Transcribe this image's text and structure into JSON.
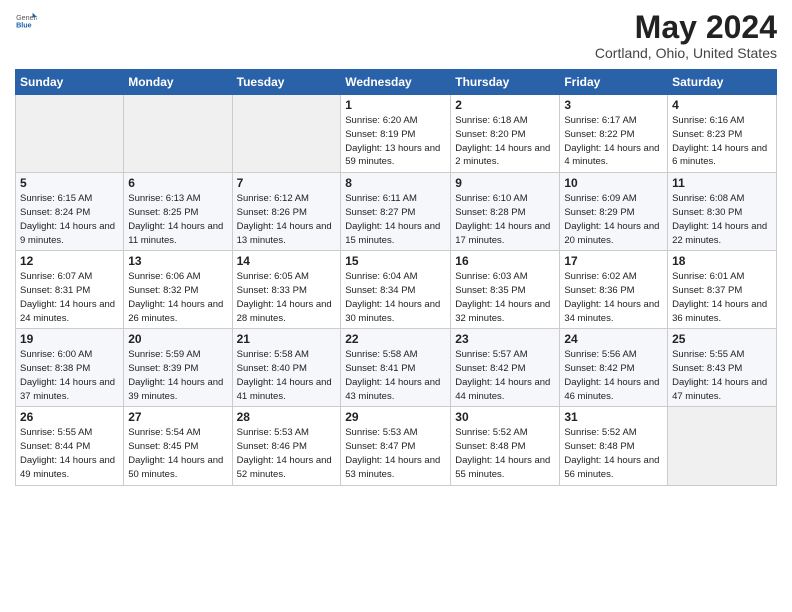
{
  "logo": {
    "general": "General",
    "blue": "Blue"
  },
  "title": "May 2024",
  "location": "Cortland, Ohio, United States",
  "days_of_week": [
    "Sunday",
    "Monday",
    "Tuesday",
    "Wednesday",
    "Thursday",
    "Friday",
    "Saturday"
  ],
  "weeks": [
    [
      {
        "day": "",
        "info": ""
      },
      {
        "day": "",
        "info": ""
      },
      {
        "day": "",
        "info": ""
      },
      {
        "day": "1",
        "info": "Sunrise: 6:20 AM\nSunset: 8:19 PM\nDaylight: 13 hours\nand 59 minutes."
      },
      {
        "day": "2",
        "info": "Sunrise: 6:18 AM\nSunset: 8:20 PM\nDaylight: 14 hours\nand 2 minutes."
      },
      {
        "day": "3",
        "info": "Sunrise: 6:17 AM\nSunset: 8:22 PM\nDaylight: 14 hours\nand 4 minutes."
      },
      {
        "day": "4",
        "info": "Sunrise: 6:16 AM\nSunset: 8:23 PM\nDaylight: 14 hours\nand 6 minutes."
      }
    ],
    [
      {
        "day": "5",
        "info": "Sunrise: 6:15 AM\nSunset: 8:24 PM\nDaylight: 14 hours\nand 9 minutes."
      },
      {
        "day": "6",
        "info": "Sunrise: 6:13 AM\nSunset: 8:25 PM\nDaylight: 14 hours\nand 11 minutes."
      },
      {
        "day": "7",
        "info": "Sunrise: 6:12 AM\nSunset: 8:26 PM\nDaylight: 14 hours\nand 13 minutes."
      },
      {
        "day": "8",
        "info": "Sunrise: 6:11 AM\nSunset: 8:27 PM\nDaylight: 14 hours\nand 15 minutes."
      },
      {
        "day": "9",
        "info": "Sunrise: 6:10 AM\nSunset: 8:28 PM\nDaylight: 14 hours\nand 17 minutes."
      },
      {
        "day": "10",
        "info": "Sunrise: 6:09 AM\nSunset: 8:29 PM\nDaylight: 14 hours\nand 20 minutes."
      },
      {
        "day": "11",
        "info": "Sunrise: 6:08 AM\nSunset: 8:30 PM\nDaylight: 14 hours\nand 22 minutes."
      }
    ],
    [
      {
        "day": "12",
        "info": "Sunrise: 6:07 AM\nSunset: 8:31 PM\nDaylight: 14 hours\nand 24 minutes."
      },
      {
        "day": "13",
        "info": "Sunrise: 6:06 AM\nSunset: 8:32 PM\nDaylight: 14 hours\nand 26 minutes."
      },
      {
        "day": "14",
        "info": "Sunrise: 6:05 AM\nSunset: 8:33 PM\nDaylight: 14 hours\nand 28 minutes."
      },
      {
        "day": "15",
        "info": "Sunrise: 6:04 AM\nSunset: 8:34 PM\nDaylight: 14 hours\nand 30 minutes."
      },
      {
        "day": "16",
        "info": "Sunrise: 6:03 AM\nSunset: 8:35 PM\nDaylight: 14 hours\nand 32 minutes."
      },
      {
        "day": "17",
        "info": "Sunrise: 6:02 AM\nSunset: 8:36 PM\nDaylight: 14 hours\nand 34 minutes."
      },
      {
        "day": "18",
        "info": "Sunrise: 6:01 AM\nSunset: 8:37 PM\nDaylight: 14 hours\nand 36 minutes."
      }
    ],
    [
      {
        "day": "19",
        "info": "Sunrise: 6:00 AM\nSunset: 8:38 PM\nDaylight: 14 hours\nand 37 minutes."
      },
      {
        "day": "20",
        "info": "Sunrise: 5:59 AM\nSunset: 8:39 PM\nDaylight: 14 hours\nand 39 minutes."
      },
      {
        "day": "21",
        "info": "Sunrise: 5:58 AM\nSunset: 8:40 PM\nDaylight: 14 hours\nand 41 minutes."
      },
      {
        "day": "22",
        "info": "Sunrise: 5:58 AM\nSunset: 8:41 PM\nDaylight: 14 hours\nand 43 minutes."
      },
      {
        "day": "23",
        "info": "Sunrise: 5:57 AM\nSunset: 8:42 PM\nDaylight: 14 hours\nand 44 minutes."
      },
      {
        "day": "24",
        "info": "Sunrise: 5:56 AM\nSunset: 8:42 PM\nDaylight: 14 hours\nand 46 minutes."
      },
      {
        "day": "25",
        "info": "Sunrise: 5:55 AM\nSunset: 8:43 PM\nDaylight: 14 hours\nand 47 minutes."
      }
    ],
    [
      {
        "day": "26",
        "info": "Sunrise: 5:55 AM\nSunset: 8:44 PM\nDaylight: 14 hours\nand 49 minutes."
      },
      {
        "day": "27",
        "info": "Sunrise: 5:54 AM\nSunset: 8:45 PM\nDaylight: 14 hours\nand 50 minutes."
      },
      {
        "day": "28",
        "info": "Sunrise: 5:53 AM\nSunset: 8:46 PM\nDaylight: 14 hours\nand 52 minutes."
      },
      {
        "day": "29",
        "info": "Sunrise: 5:53 AM\nSunset: 8:47 PM\nDaylight: 14 hours\nand 53 minutes."
      },
      {
        "day": "30",
        "info": "Sunrise: 5:52 AM\nSunset: 8:48 PM\nDaylight: 14 hours\nand 55 minutes."
      },
      {
        "day": "31",
        "info": "Sunrise: 5:52 AM\nSunset: 8:48 PM\nDaylight: 14 hours\nand 56 minutes."
      },
      {
        "day": "",
        "info": ""
      }
    ]
  ]
}
